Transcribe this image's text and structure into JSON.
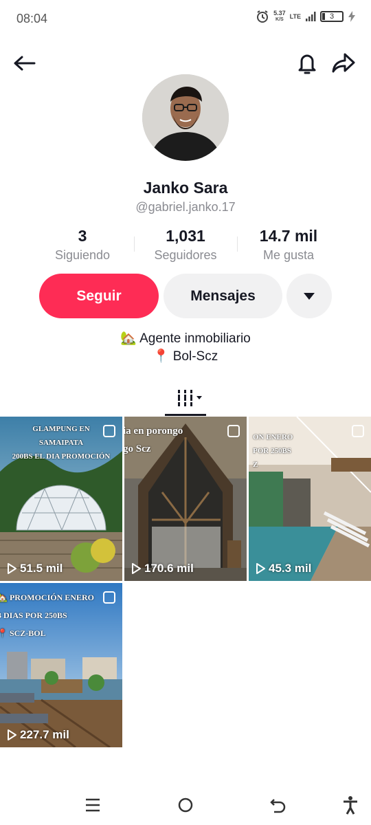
{
  "status_bar": {
    "time": "08:04",
    "net_speed_value": "5.37",
    "net_speed_unit": "K/S",
    "network_type": "LTE",
    "battery_level": "3"
  },
  "header": {
    "back_icon": "arrow-left-icon",
    "bell_icon": "bell-icon",
    "share_icon": "share-arrow-icon"
  },
  "profile": {
    "name": "Janko Sara",
    "handle": "@gabriel.janko.17",
    "stats": [
      {
        "value": "3",
        "label": "Siguiendo"
      },
      {
        "value": "1,031",
        "label": "Seguidores"
      },
      {
        "value": "14.7 mil",
        "label": "Me gusta"
      }
    ],
    "follow_label": "Seguir",
    "message_label": "Mensajes",
    "bio_line_1": "🏡 Agente inmobiliario",
    "bio_line_2": "📍 Bol-Scz"
  },
  "tabs": {
    "videos_icon": "grid-bars-icon"
  },
  "videos": [
    {
      "caption_1": "GLAMPUNG EN",
      "caption_2": "SAMAIPATA",
      "caption_3": "200BS EL DIA PROMOCIÓN",
      "views": "51.5 mil"
    },
    {
      "caption_1": "ia en porongo",
      "caption_2": "go Scz",
      "caption_3": "",
      "views": "170.6 mil"
    },
    {
      "caption_1": "ON ENERO",
      "caption_2": "POR 250BS",
      "caption_3": "Z",
      "views": "45.3 mil"
    },
    {
      "caption_1": "🏡 PROMOCIÓN ENERO",
      "caption_2": "3 DIAS POR 250BS",
      "caption_3": "📍 SCZ-BOL",
      "views": "227.7 mil"
    }
  ],
  "colors": {
    "accent": "#fe2c55",
    "secondary_button": "#f1f1f2",
    "muted_text": "#8a8b91"
  }
}
